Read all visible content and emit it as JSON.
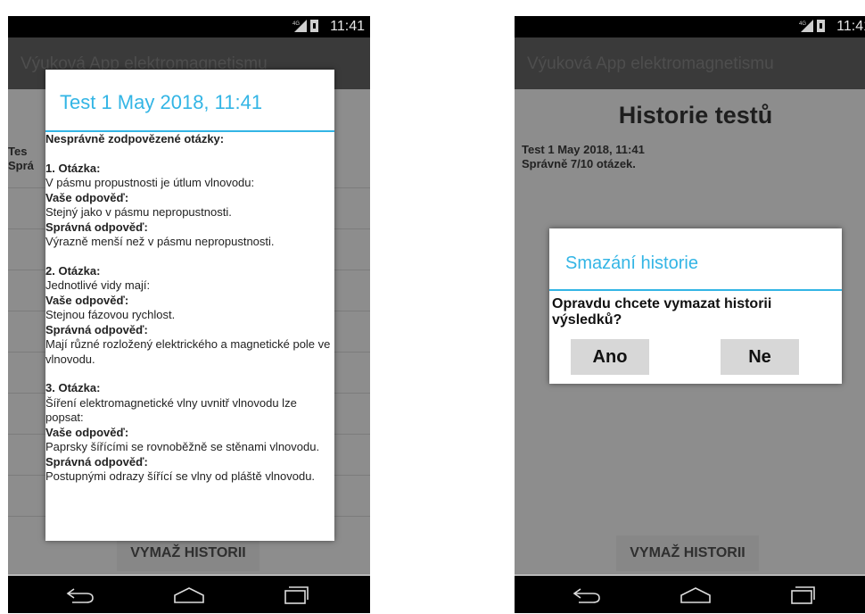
{
  "status": {
    "network_label": "4G",
    "time": "11:41"
  },
  "app": {
    "title": "Výuková App elektromagnetismu"
  },
  "history": {
    "heading": "Historie testů",
    "item_title": "Test  1 May 2018, 11:41",
    "item_sub": "Správně 7/10 otázek.",
    "left_title_fragment": "Tes",
    "left_sub_fragment": "Sprá",
    "clear_button": "VYMAŽ HISTORII"
  },
  "result_dialog": {
    "title": "Test  1 May 2018, 11:41",
    "intro": "Nesprávně zodpovězené otázky:",
    "your_answer_label": "Vaše odpověď:",
    "correct_answer_label": "Správná odpověď:",
    "questions": [
      {
        "label": "1. Otázka:",
        "question": "V pásmu propustnosti je útlum vlnovodu:",
        "your_answer": "Stejný jako v pásmu nepropustnosti.",
        "correct_answer": "Výrazně menší než v pásmu nepropustnosti."
      },
      {
        "label": "2. Otázka:",
        "question": "Jednotlivé vidy mají:",
        "your_answer": "Stejnou fázovou rychlost.",
        "correct_answer": "Mají různé rozložený elektrického a magnetické pole ve vlnovodu."
      },
      {
        "label": "3. Otázka:",
        "question": "Šíření elektromagnetické vlny uvnitř vlnovodu lze popsat:",
        "your_answer": "Paprsky šířícími se rovnoběžně se stěnami vlnovodu.",
        "correct_answer": "Postupnými odrazy šířící se vlny od pláště vlnovodu."
      }
    ]
  },
  "confirm_dialog": {
    "title": "Smazání historie",
    "message": "Opravdu chcete vymazat historii výsledků?",
    "yes": "Ano",
    "no": "Ne"
  },
  "icons": {
    "back": "back-icon",
    "home": "home-icon",
    "recent": "recent-apps-icon",
    "signal": "signal-icon",
    "battery": "battery-icon"
  },
  "colors": {
    "accent": "#33b5e5",
    "actionbar": "#3a3a3a"
  }
}
